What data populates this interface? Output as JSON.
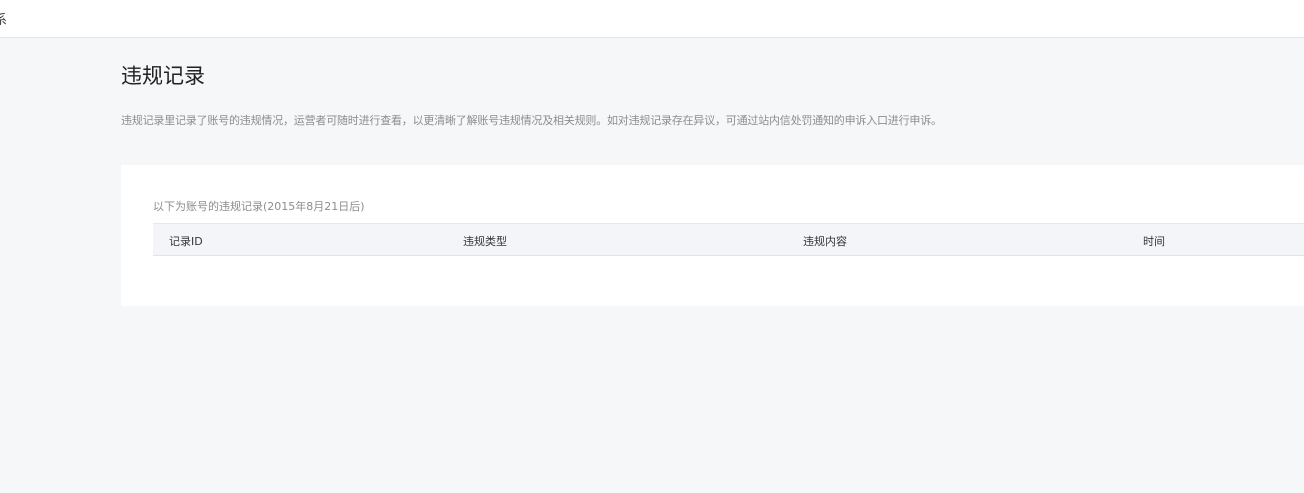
{
  "topbar": {
    "fragment": "系"
  },
  "page": {
    "title": "违规记录",
    "description": "违规记录里记录了账号的违规情况，运营者可随时进行查看，以更清晰了解账号违规情况及相关规则。如对违规记录存在异议，可通过站内信处罚通知的申诉入口进行申诉。"
  },
  "records": {
    "subtitle": "以下为账号的违规记录(2015年8月21日后)",
    "columns": [
      "记录ID",
      "违规类型",
      "违规内容",
      "时间"
    ],
    "rows": []
  }
}
